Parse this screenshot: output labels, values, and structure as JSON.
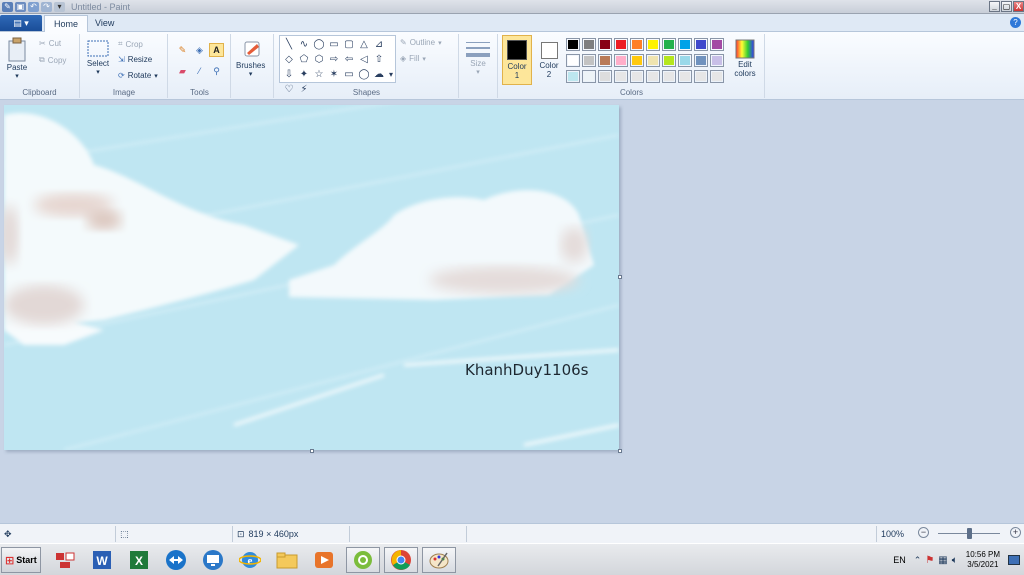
{
  "window": {
    "title": "Untitled - Paint",
    "buttons": {
      "minimize": "_",
      "restore": "▢",
      "close": "X"
    }
  },
  "tabs": {
    "file": "▤ ▾",
    "home": "Home",
    "view": "View",
    "help": "?"
  },
  "clipboard": {
    "label": "Clipboard",
    "paste": "Paste",
    "cut": "Cut",
    "copy": "Copy"
  },
  "image": {
    "label": "Image",
    "select": "Select",
    "crop": "Crop",
    "resize": "Resize",
    "rotate": "Rotate"
  },
  "tools": {
    "label": "Tools"
  },
  "brushes": {
    "label": "Brushes"
  },
  "shapes": {
    "label": "Shapes",
    "outline": "Outline",
    "fill": "Fill",
    "glyphs": [
      "╲",
      "∿",
      "◯",
      "▭",
      "▢",
      "△",
      "⊿",
      "◇",
      "⬠",
      "⬡",
      "⇨",
      "⇦",
      "◁",
      "⇧",
      "⇩",
      "✦",
      "☆",
      "✶",
      "▭",
      "◯",
      "☁",
      "♡",
      "⚡",
      "▤"
    ]
  },
  "size": {
    "label": "Size"
  },
  "colors": {
    "label": "Colors",
    "color1": "Color 1",
    "color2": "Color 2",
    "edit": "Edit colors",
    "color1_value": "#000000",
    "color2_value": "#ffffff",
    "palette_row1": [
      "#000000",
      "#7f7f7f",
      "#880015",
      "#ed1c24",
      "#ff7f27",
      "#fff200",
      "#22b14c",
      "#00a2e8",
      "#3f48cc",
      "#a349a4"
    ],
    "palette_row2": [
      "#ffffff",
      "#c3c3c3",
      "#b97a57",
      "#ffaec9",
      "#ffc90e",
      "#efe4b0",
      "#b5e61d",
      "#99d9ea",
      "#7092be",
      "#c8bfe7"
    ],
    "palette_row3": [
      "#bde7ef",
      "#eef4f7",
      "#ddd",
      "#e6e6e6",
      "#e6e6e6",
      "#e6e6e6",
      "#e6e6e6",
      "#e6e6e6",
      "#e6e6e6",
      "#e6e6e6"
    ]
  },
  "canvas": {
    "watermark": "KhanhDuy1106s"
  },
  "status": {
    "dimensions": "819 × 460px",
    "zoom": "100%",
    "zoom_fraction": 0.5
  },
  "taskbar": {
    "start": "Start",
    "lang": "EN",
    "time": "10:56 PM",
    "date": "3/5/2021"
  }
}
